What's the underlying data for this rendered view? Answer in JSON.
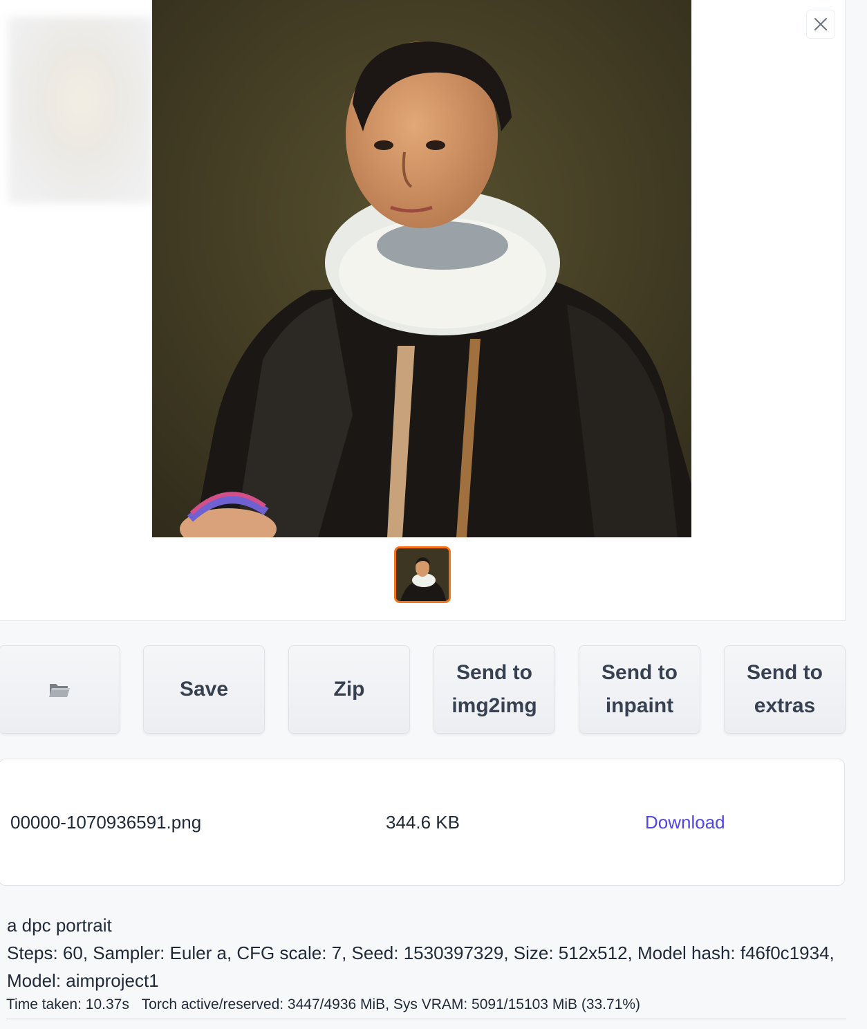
{
  "gallery": {
    "close_icon": "close-icon",
    "preview_alt": "portrait painting",
    "thumbnail_selected_color": "#f97316"
  },
  "actions": {
    "folder_icon": "folder-icon",
    "save_label": "Save",
    "zip_label": "Zip",
    "send_img2img_line1": "Send to",
    "send_img2img_line2": "img2img",
    "send_inpaint_line1": "Send to",
    "send_inpaint_line2": "inpaint",
    "send_extras_line1": "Send to",
    "send_extras_line2": "extras"
  },
  "files": [
    {
      "name": "00000-1070936591.png",
      "size": "344.6 KB",
      "link": "Download"
    }
  ],
  "generation": {
    "prompt": "a dpc portrait",
    "params_line1": "Steps: 60, Sampler: Euler a, CFG scale: 7, Seed: 1530397329, Size: 512x512, Model hash: f46f0c1934,",
    "params_line2": "Model: aimproject1"
  },
  "performance": {
    "time_taken": "Time taken: 10.37s",
    "memory": "Torch active/reserved: 3447/4936 MiB, Sys VRAM: 5091/15103 MiB (33.71%)"
  },
  "colors": {
    "accent_link": "#4f46e5",
    "selected_border": "#f97316"
  }
}
